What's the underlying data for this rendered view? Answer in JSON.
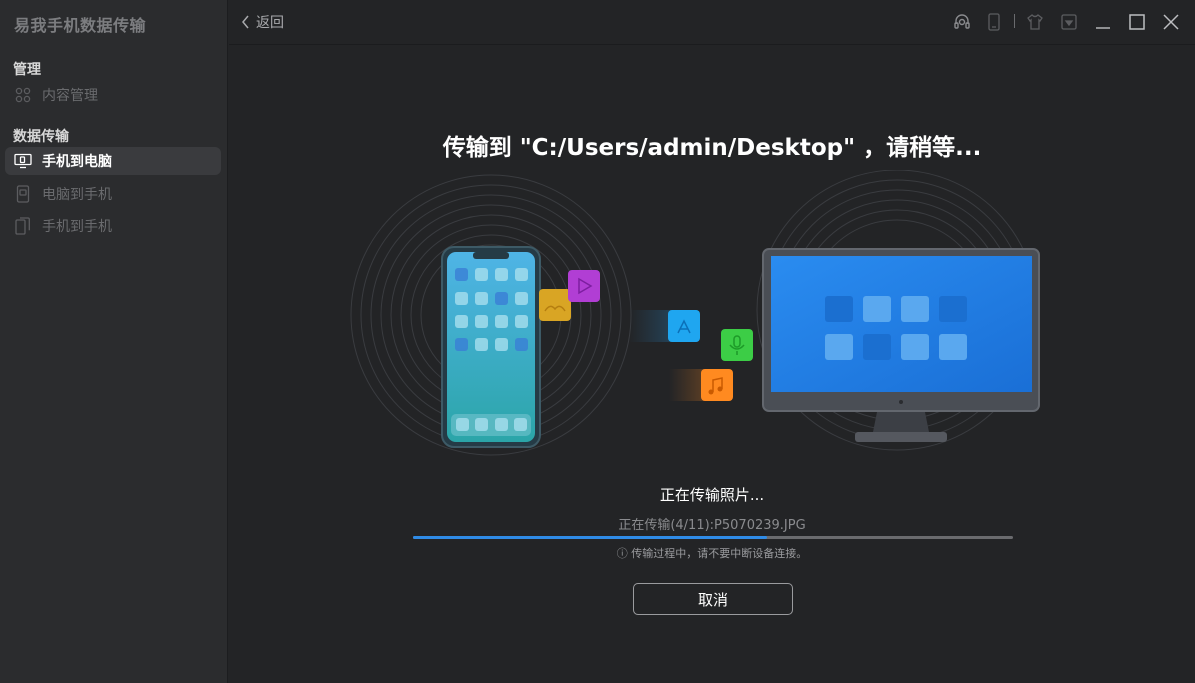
{
  "app": {
    "title": "易我手机数据传输"
  },
  "sidebar": {
    "sections": [
      {
        "label": "管理",
        "items": [
          {
            "label": "内容管理",
            "icon": "grid-icon"
          }
        ]
      },
      {
        "label": "数据传输",
        "items": [
          {
            "label": "手机到电脑",
            "icon": "phone-to-pc-icon",
            "active": true
          },
          {
            "label": "电脑到手机",
            "icon": "pc-to-phone-icon"
          },
          {
            "label": "手机到手机",
            "icon": "phone-to-phone-icon"
          }
        ]
      }
    ]
  },
  "topbar": {
    "back_label": "返回",
    "icons": [
      "headset-icon",
      "phone-icon",
      "shirt-icon",
      "download-icon",
      "minimize-icon",
      "maximize-icon",
      "close-icon"
    ]
  },
  "main": {
    "heading": "传输到 \"C:/Users/admin/Desktop\" ，请稍等...",
    "status": "正在传输照片...",
    "file_progress": "正在传输(4/11):P5070239.JPG",
    "progress_fraction": 0.59,
    "warning": "ⓘ 传输过程中，请不要中断设备连接。",
    "cancel_label": "取消"
  },
  "colors": {
    "accent": "#2f8be6",
    "background": "#232426",
    "sidebar": "#2b2c2e"
  }
}
